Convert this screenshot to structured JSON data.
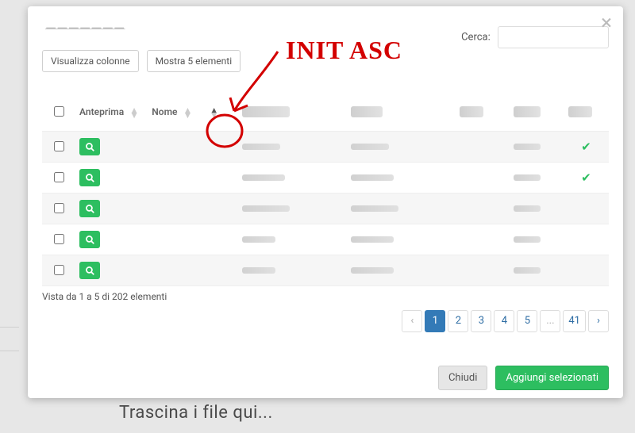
{
  "backdrop": {
    "text": "Trascina i file qui..."
  },
  "modal": {
    "title": "———————",
    "close": "×",
    "toolbar": {
      "columns_btn": "Visualizza colonne",
      "length_btn": "Mostra 5 elementi"
    },
    "search": {
      "label": "Cerca:",
      "placeholder": ""
    },
    "table": {
      "headers": {
        "checkbox": "",
        "preview": "Anteprima",
        "name": "Nome",
        "c4": "———",
        "c5": "———",
        "c6": "———",
        "c7": "———",
        "c8": "———"
      },
      "sort_state": {
        "column": "c4",
        "order": "asc"
      },
      "rows": [
        {
          "checked": false,
          "c4": "———",
          "c5": "———",
          "c6": "",
          "c7": "———",
          "c8_check": true
        },
        {
          "checked": false,
          "c4": "————",
          "c5": "————",
          "c6": "",
          "c7": "———",
          "c8_check": true
        },
        {
          "checked": false,
          "c4": "—————",
          "c5": "—————",
          "c6": "",
          "c7": "———",
          "c8_check": false
        },
        {
          "checked": false,
          "c4": "——",
          "c5": "————",
          "c6": "",
          "c7": "———",
          "c8_check": false
        },
        {
          "checked": false,
          "c4": "——",
          "c5": "————",
          "c6": "",
          "c7": "————",
          "c8_check": false
        }
      ]
    },
    "info": "Vista da 1 a 5 di 202 elementi",
    "pagination": {
      "prev": "‹",
      "pages": [
        "1",
        "2",
        "3",
        "4",
        "5",
        "...",
        "41"
      ],
      "current": "1",
      "next": "›"
    },
    "footer": {
      "close": "Chiudi",
      "add": "Aggiungi selezionati"
    }
  },
  "annotation": {
    "text": "INIT ASC"
  }
}
